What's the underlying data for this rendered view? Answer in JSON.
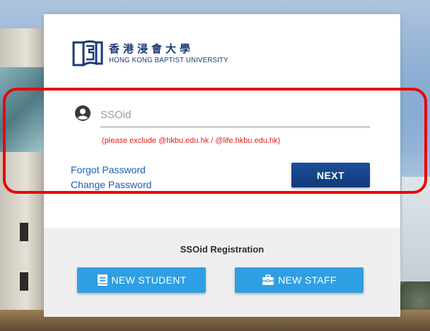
{
  "logo": {
    "chinese_name": "香港浸會大學",
    "english_name": "HONG KONG BAPTIST UNIVERSITY",
    "brand_color": "#1b3a77",
    "icon": "hkbu-logo-icon"
  },
  "login": {
    "ssoid_placeholder": "SSOid",
    "ssoid_value": "",
    "user_icon": "user-circle-icon",
    "hint": "(please exclude @hkbu.edu.hk / @life.hkbu.edu.hk)",
    "hint_color": "#e0201c",
    "forgot_password": "Forgot Password",
    "change_password": "Change Password",
    "next_label": "NEXT",
    "next_color": "#0f3a7a"
  },
  "registration": {
    "title": "SSOid Registration",
    "new_student_label": "NEW STUDENT",
    "new_student_icon": "book-icon",
    "new_staff_label": "NEW STAFF",
    "new_staff_icon": "briefcase-icon",
    "button_color": "#2f9fe3"
  },
  "annotation": {
    "highlight_color": "#e8070b"
  }
}
